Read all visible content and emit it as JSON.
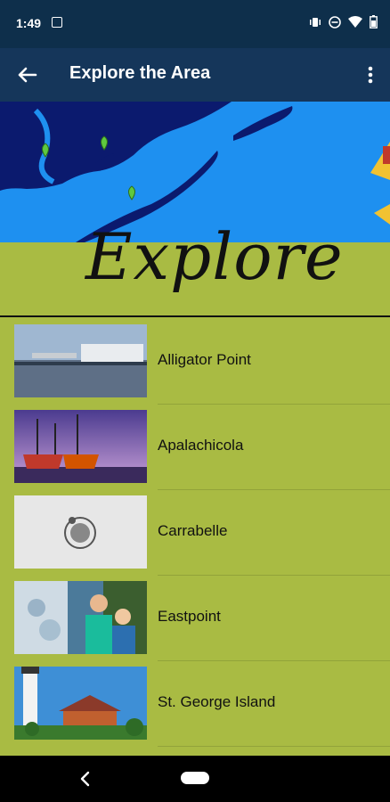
{
  "status_bar": {
    "time": "1:49",
    "icons": [
      "image-icon",
      "vibrate-icon",
      "do-not-disturb-icon",
      "wifi-icon",
      "battery-icon"
    ]
  },
  "app_bar": {
    "title": "Explore the Area",
    "back_icon": "arrow-left-icon",
    "menu_icon": "more-vert-icon"
  },
  "hero": {
    "banner_text": "Explore"
  },
  "locations": [
    {
      "label": "Alligator Point",
      "thumb": "marina-photo"
    },
    {
      "label": "Apalachicola",
      "thumb": "shrimp-boats-photo"
    },
    {
      "label": "Carrabelle",
      "thumb": "logo-placeholder"
    },
    {
      "label": "Eastpoint",
      "thumb": "family-photo"
    },
    {
      "label": "St. George Island",
      "thumb": "lighthouse-photo"
    }
  ],
  "colors": {
    "status_bar": "#0e2f4b",
    "app_bar": "#15365a",
    "background": "#a9bb43",
    "sky": "#1e90f0",
    "land": "#0b1a6e",
    "banner_band": "#a9bb43"
  }
}
